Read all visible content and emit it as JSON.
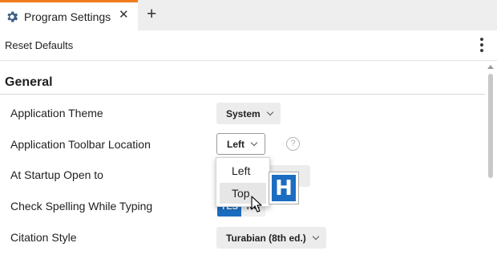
{
  "tab": {
    "title": "Program Settings",
    "close_glyph": "✕",
    "new_tab_glyph": "+"
  },
  "toolbar": {
    "reset_label": "Reset Defaults"
  },
  "section": {
    "title": "General"
  },
  "settings": [
    {
      "label": "Application Theme",
      "value": "System"
    },
    {
      "label": "Application Toolbar Location",
      "value": "Left"
    },
    {
      "label": "At Startup Open to",
      "value": ""
    },
    {
      "label": "Check Spelling While Typing",
      "yes": "YES",
      "no": "NO"
    },
    {
      "label": "Citation Style",
      "value": "Turabian (8th ed.)"
    }
  ],
  "help_glyph": "?",
  "toolbar_menu": {
    "items": [
      "Left",
      "Top"
    ],
    "highlighted": "Top"
  },
  "badge": {
    "letter": "H"
  },
  "colors": {
    "accent": "#1c6dc1",
    "tab_underline": "#f07c1b"
  }
}
